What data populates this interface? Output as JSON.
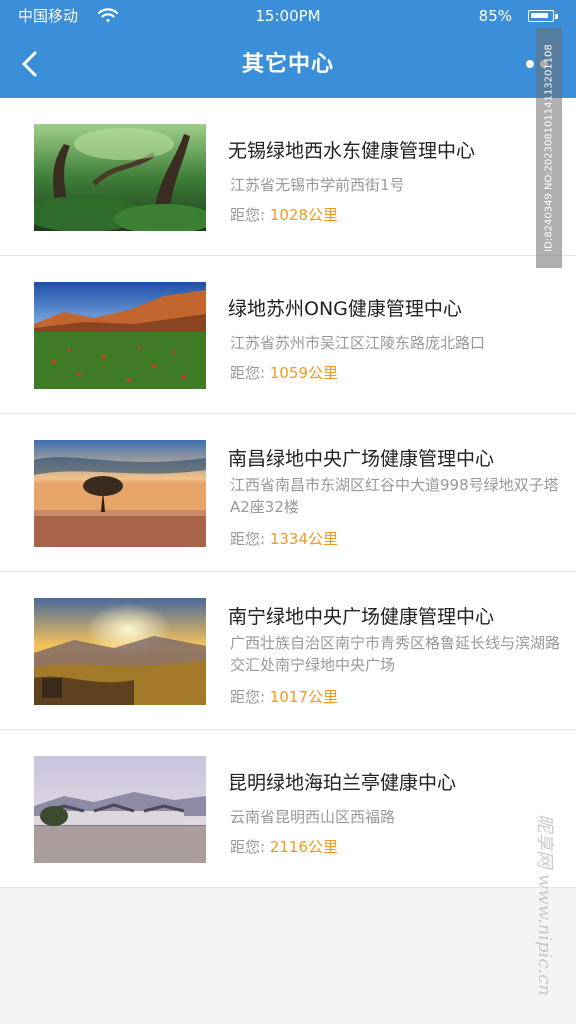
{
  "status_bar": {
    "carrier": "中国移动",
    "time": "15:00PM",
    "battery": "85%",
    "battery_level": 0.85
  },
  "nav": {
    "title": "其它中心",
    "back_icon": "chevron-left-icon",
    "more_icon": "more-dots-icon"
  },
  "centers": [
    {
      "name": "无锡绿地西水东健康管理中心",
      "address": "江苏省无锡市学前西街1号",
      "distance_label": "距您:",
      "distance": "1028公里",
      "image": "forest-photo"
    },
    {
      "name": "绿地苏州ONG健康管理中心",
      "address": "江苏省苏州市吴江区江陵东路庞北路口",
      "distance_label": "距您:",
      "distance": "1059公里",
      "image": "mountain-meadow-photo"
    },
    {
      "name": "南昌绿地中央广场健康管理中心",
      "address": "江西省南昌市东湖区红谷中大道998号绿地双子塔A2座32楼",
      "distance_label": "距您:",
      "distance": "1334公里",
      "image": "lone-tree-photo"
    },
    {
      "name": "南宁绿地中央广场健康管理中心",
      "address": "广西壮族自治区南宁市青秀区格鲁延长线与滨湖路交汇处南宁绿地中央广场",
      "distance_label": "距您:",
      "distance": "1017公里",
      "image": "sunrise-hills-photo"
    },
    {
      "name": "昆明绿地海珀兰亭健康中心",
      "address": "云南省昆明西山区西福路",
      "distance_label": "距您:",
      "distance": "2116公里",
      "image": "lake-village-photo"
    }
  ],
  "watermarks": {
    "id_text": "ID:8240349 NO:20230810114113201108",
    "site_text": "昵享网 www.nipic.cn"
  }
}
